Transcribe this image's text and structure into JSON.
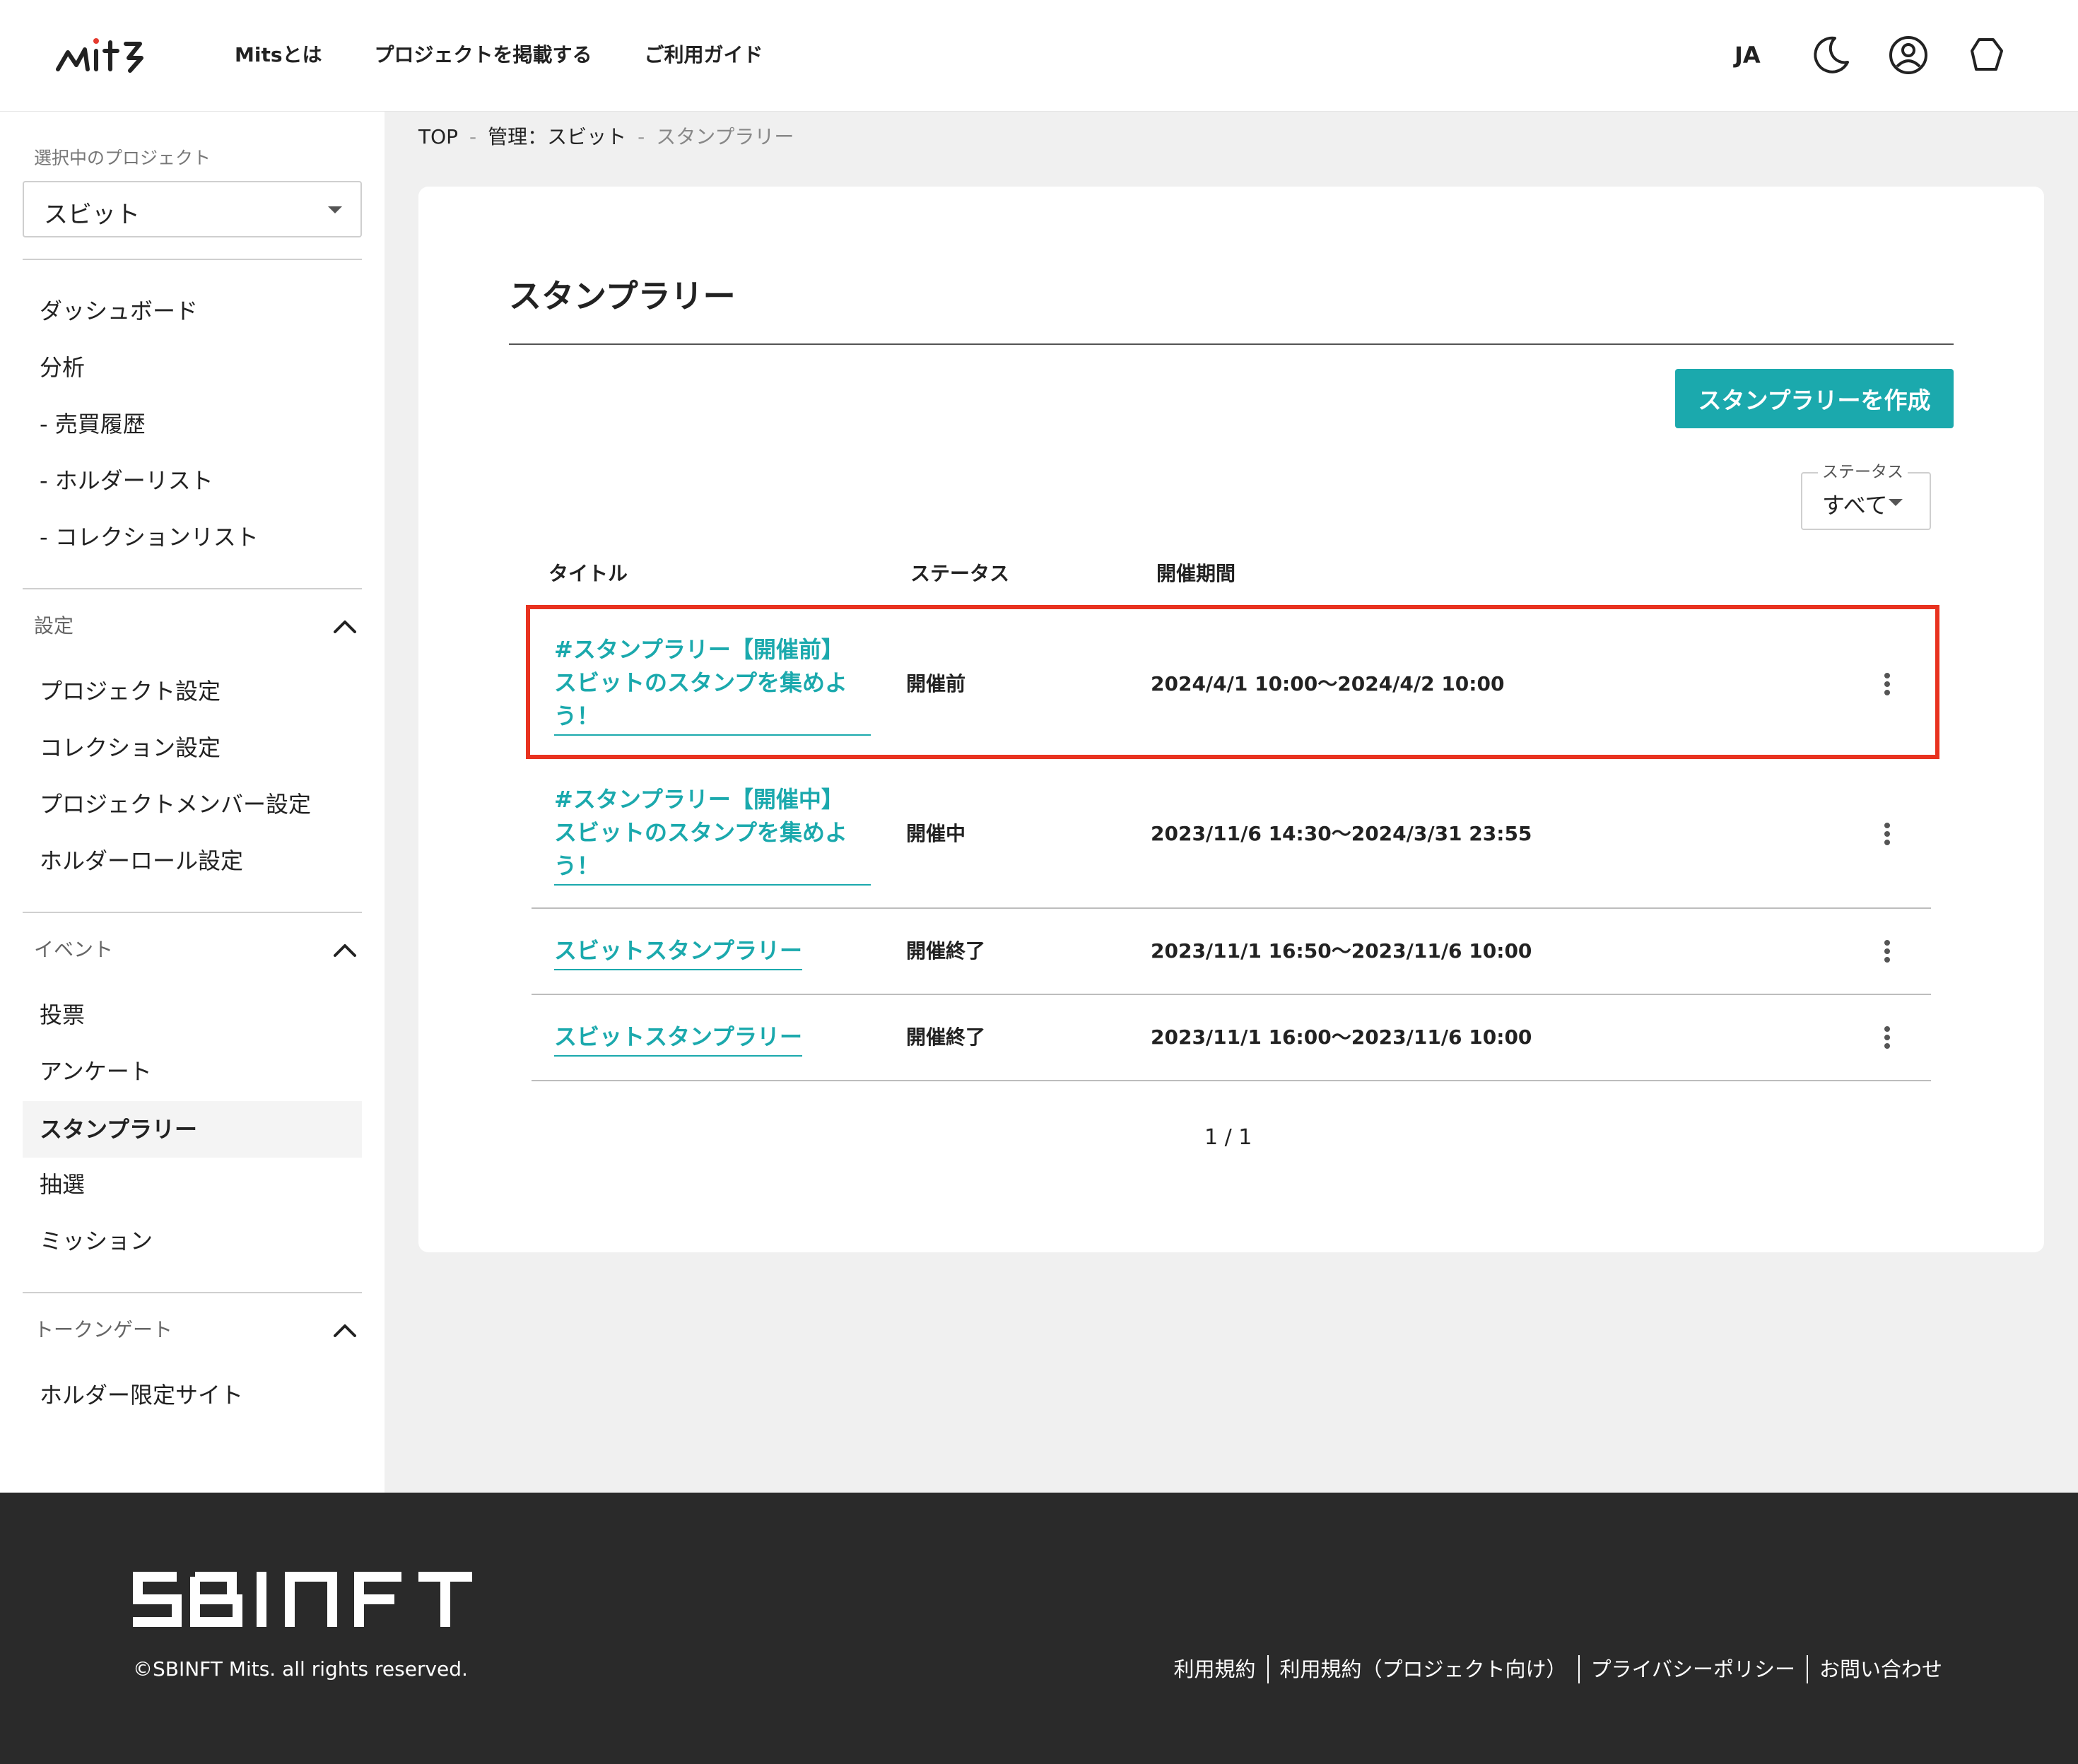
{
  "header": {
    "nav": [
      "Mitsとは",
      "プロジェクトを掲載する",
      "ご利用ガイド"
    ],
    "lang": "JA",
    "icons": [
      "moon-icon",
      "account-icon",
      "wallet-icon"
    ]
  },
  "sidebar": {
    "project_label": "選択中のプロジェクト",
    "project_value": "スビット",
    "items": [
      "ダッシュボード",
      "分析",
      "- 売買履歴",
      "- ホルダーリスト",
      "- コレクションリスト"
    ],
    "settings": {
      "label": "設定",
      "items": [
        "プロジェクト設定",
        "コレクション設定",
        "プロジェクトメンバー設定",
        "ホルダーロール設定"
      ]
    },
    "events": {
      "label": "イベント",
      "items": [
        "投票",
        "アンケート",
        "スタンプラリー",
        "抽選",
        "ミッション"
      ]
    },
    "tokengate": {
      "label": "トークンゲート",
      "items": [
        "ホルダー限定サイト"
      ]
    }
  },
  "breadcrumb": {
    "items": [
      "TOP",
      "管理：スビット",
      "スタンプラリー"
    ]
  },
  "main": {
    "title": "スタンプラリー",
    "create_button": "スタンプラリーを作成",
    "filter_label": "ステータス",
    "filter_value": "すべて",
    "columns": [
      "タイトル",
      "ステータス",
      "開催期間"
    ],
    "rows": [
      {
        "title_lines": [
          "#スタンプラリー【開催前】",
          "スビットのスタンプを集めよ",
          "う！"
        ],
        "status": "開催前",
        "period": "2024/4/1 10:00〜2024/4/2 10:00"
      },
      {
        "title_lines": [
          "#スタンプラリー【開催中】",
          "スビットのスタンプを集めよ",
          "う！"
        ],
        "status": "開催中",
        "period": "2023/11/6 14:30〜2024/3/31 23:55"
      },
      {
        "title_lines": [
          "スビットスタンプラリー"
        ],
        "status": "開催終了",
        "period": "2023/11/1 16:50〜2023/11/6 10:00"
      },
      {
        "title_lines": [
          "スビットスタンプラリー"
        ],
        "status": "開催終了",
        "period": "2023/11/1 16:00〜2023/11/6 10:00"
      }
    ],
    "pager": "1 / 1",
    "highlight_color": "#e8321f",
    "accent_color": "#1ba9ad"
  },
  "footer": {
    "brand": "SBINFT",
    "copyright": "©SBINFT Mits. all rights reserved.",
    "links": [
      "利用規約",
      "利用規約（プロジェクト向け）",
      "プライバシーポリシー",
      "お問い合わせ"
    ]
  }
}
